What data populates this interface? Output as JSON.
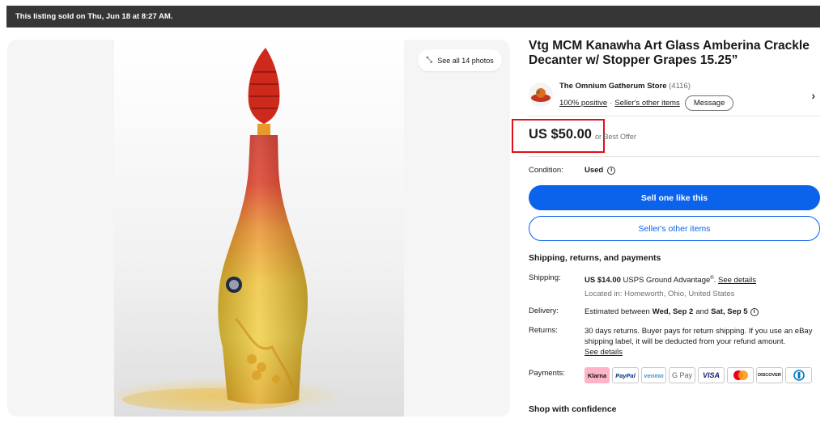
{
  "banner": {
    "text": "This listing sold on Thu, Jun 18 at 8:27 AM."
  },
  "gallery": {
    "see_all_label": "See all 14 photos",
    "expand_icon": "expand-icon"
  },
  "item": {
    "title": "Vtg MCM Kanawha Art Glass Amberina Crackle Decanter w/ Stopper Grapes 15.25”"
  },
  "seller": {
    "name": "The Omnium Gatherum Store",
    "feedback_count": "(4116)",
    "positive": "100% positive",
    "separator": "·",
    "other_items": "Seller's other items",
    "message_label": "Message"
  },
  "price": {
    "amount": "US $50.00",
    "best_offer": "or Best Offer"
  },
  "condition": {
    "label": "Condition:",
    "value": "Used"
  },
  "buttons": {
    "sell_one": "Sell one like this",
    "sellers_other": "Seller's other items"
  },
  "shipping_section": {
    "title": "Shipping, returns, and payments",
    "shipping_label": "Shipping:",
    "shipping_cost": "US $14.00",
    "shipping_service": "USPS Ground Advantage",
    "shipping_reg": "®",
    "see_details": "See details",
    "located_in": "Located in: Homeworth, Ohio, United States",
    "delivery_label": "Delivery:",
    "delivery_prefix": "Estimated between",
    "delivery_start": "Wed, Sep 2",
    "delivery_and": "and",
    "delivery_end": "Sat, Sep 5",
    "returns_label": "Returns:",
    "returns_text": "30 days returns. Buyer pays for return shipping. If you use an eBay shipping label, it will be deducted from your refund amount.",
    "returns_details": "See details",
    "payments_label": "Payments:",
    "payment_methods": [
      "Klarna",
      "PayPal",
      "venmo",
      "G Pay",
      "VISA",
      "Mastercard",
      "DISCOVER",
      "Diners"
    ]
  },
  "shop_confidence": {
    "title": "Shop with confidence"
  },
  "colors": {
    "primary": "#0b63ec",
    "highlight": "#e0101a",
    "banner": "#363636"
  }
}
